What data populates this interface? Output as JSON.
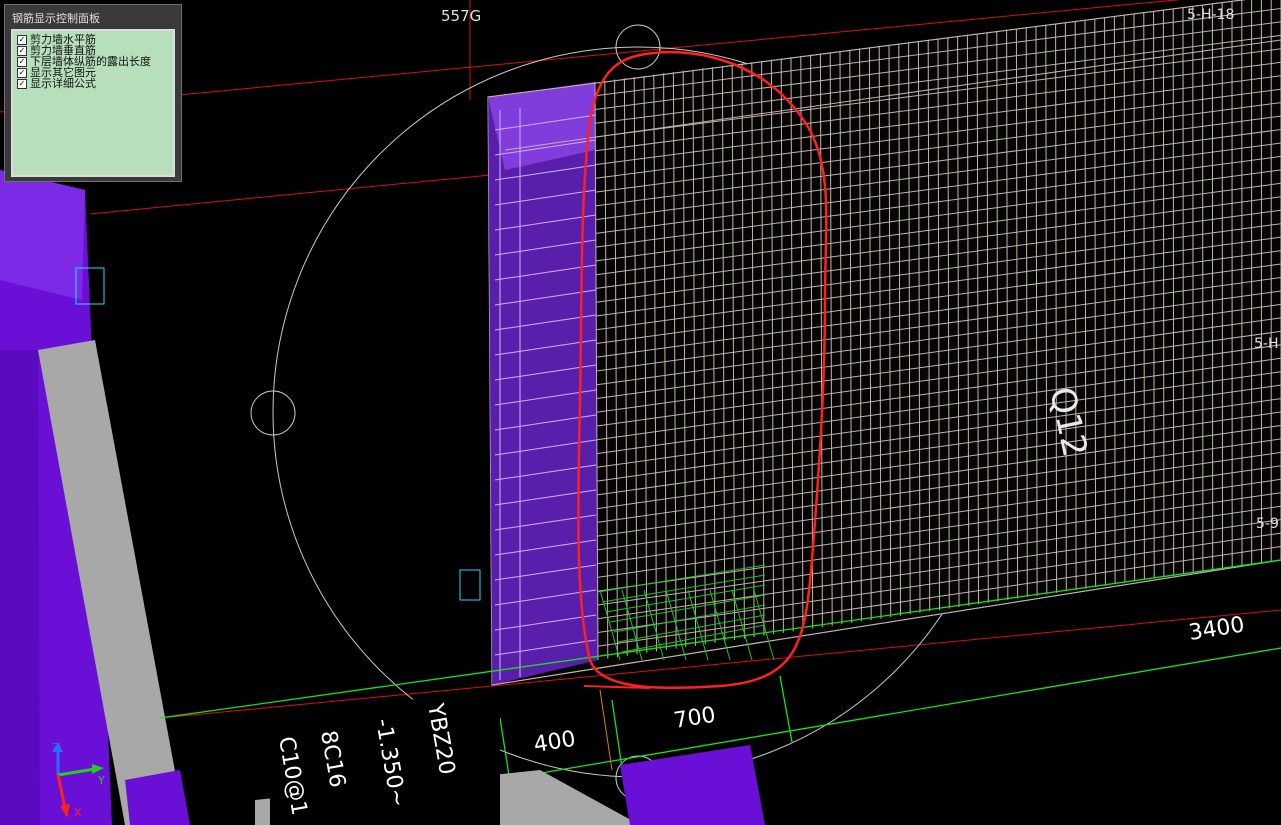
{
  "control_panel": {
    "title": "钢筋显示控制面板",
    "options": [
      {
        "label": "剪力墙水平筋",
        "checked": true
      },
      {
        "label": "剪力墙垂直筋",
        "checked": true
      },
      {
        "label": "下层墙体纵筋的露出长度",
        "checked": true
      },
      {
        "label": "显示其它图元",
        "checked": true
      },
      {
        "label": "显示详细公式",
        "checked": true
      }
    ]
  },
  "viewport_labels": {
    "axis_top": "557G",
    "axis_right_top": "5-H-18",
    "axis_right_mid": "5-H",
    "axis_right_low": "5-9",
    "wall_name": "Q12"
  },
  "dimensions": {
    "total": "3400",
    "segment_a": "400",
    "segment_b": "700"
  },
  "column_tag": {
    "lines": [
      "YBZ20",
      "-1.350~",
      "8C16",
      "C10@1"
    ]
  },
  "axes_gizmo": {
    "z": "Z",
    "y": "Y",
    "x": "X"
  },
  "colors": {
    "background": "#000000",
    "wall_purple": "#6a0fd6",
    "column_gray": "#a9a9a9",
    "rebar": "#c8b8b0",
    "grid_red": "#e01010",
    "dim_green": "#19e019",
    "annotation_red": "#ff2020"
  }
}
